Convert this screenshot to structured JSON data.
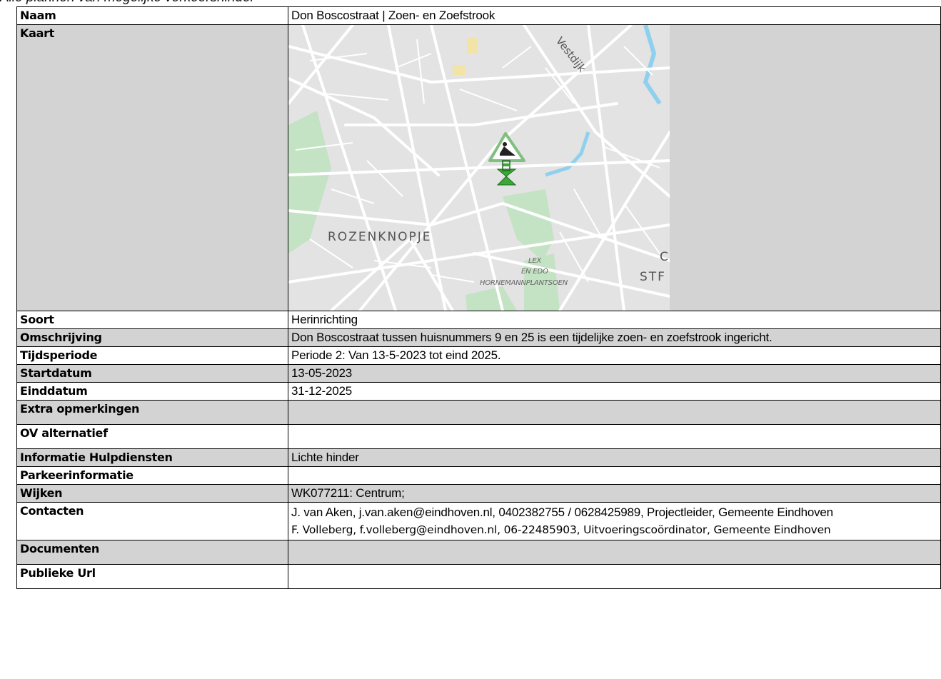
{
  "page_title": "Alle plannen van mogelijke verkeershinder",
  "rows": [
    {
      "label": "Naam",
      "value": "Don Boscostraat | Zoen- en Zoefstrook"
    },
    {
      "label": "Kaart"
    },
    {
      "label": "Soort",
      "value": "Herinrichting"
    },
    {
      "label": "Omschrijving",
      "value": "Don Boscostraat tussen huisnummers 9 en 25 is een tijdelijke zoen- en zoefstrook ingericht."
    },
    {
      "label": "Tijdsperiode",
      "value": "Periode 2: Van 13-5-2023 tot eind 2025."
    },
    {
      "label": "Startdatum",
      "value": "13-05-2023"
    },
    {
      "label": "Einddatum",
      "value": "31-12-2025"
    },
    {
      "label": "Extra opmerkingen",
      "value": ""
    },
    {
      "label": "OV alternatief",
      "value": ""
    },
    {
      "label": "Informatie Hulpdiensten",
      "value": "Lichte hinder"
    },
    {
      "label": "Parkeerinformatie",
      "value": ""
    },
    {
      "label": "Wijken",
      "value": "WK077211: Centrum;"
    },
    {
      "label": "Contacten",
      "value": "J. van Aken, j.van.aken@eindhoven.nl, 0402382755 / 0628425989, Projectleider, Gemeente Eindhoven",
      "value2": "F. Volleberg, f.volleberg@eindhoven.nl, 06-22485903, Uitvoeringscoördinator, Gemeente Eindhoven"
    },
    {
      "label": "Documenten",
      "value": ""
    },
    {
      "label": "Publieke Url",
      "value": ""
    }
  ],
  "map": {
    "labels": {
      "street": "Vestdijk",
      "district": "ROZENKNOPJE",
      "park1": "LEX",
      "park2": "EN EDO",
      "park3": "HORNEMANNPLANTSOEN",
      "edge1": "C",
      "edge2": "STF"
    },
    "colors": {
      "roads": "#ffffff",
      "land": "#e3e3e3",
      "park": "#c4e3c4",
      "water": "#8fd0ee",
      "marker": "#3aa83a"
    },
    "marker_icon": "roadwork-icon"
  }
}
